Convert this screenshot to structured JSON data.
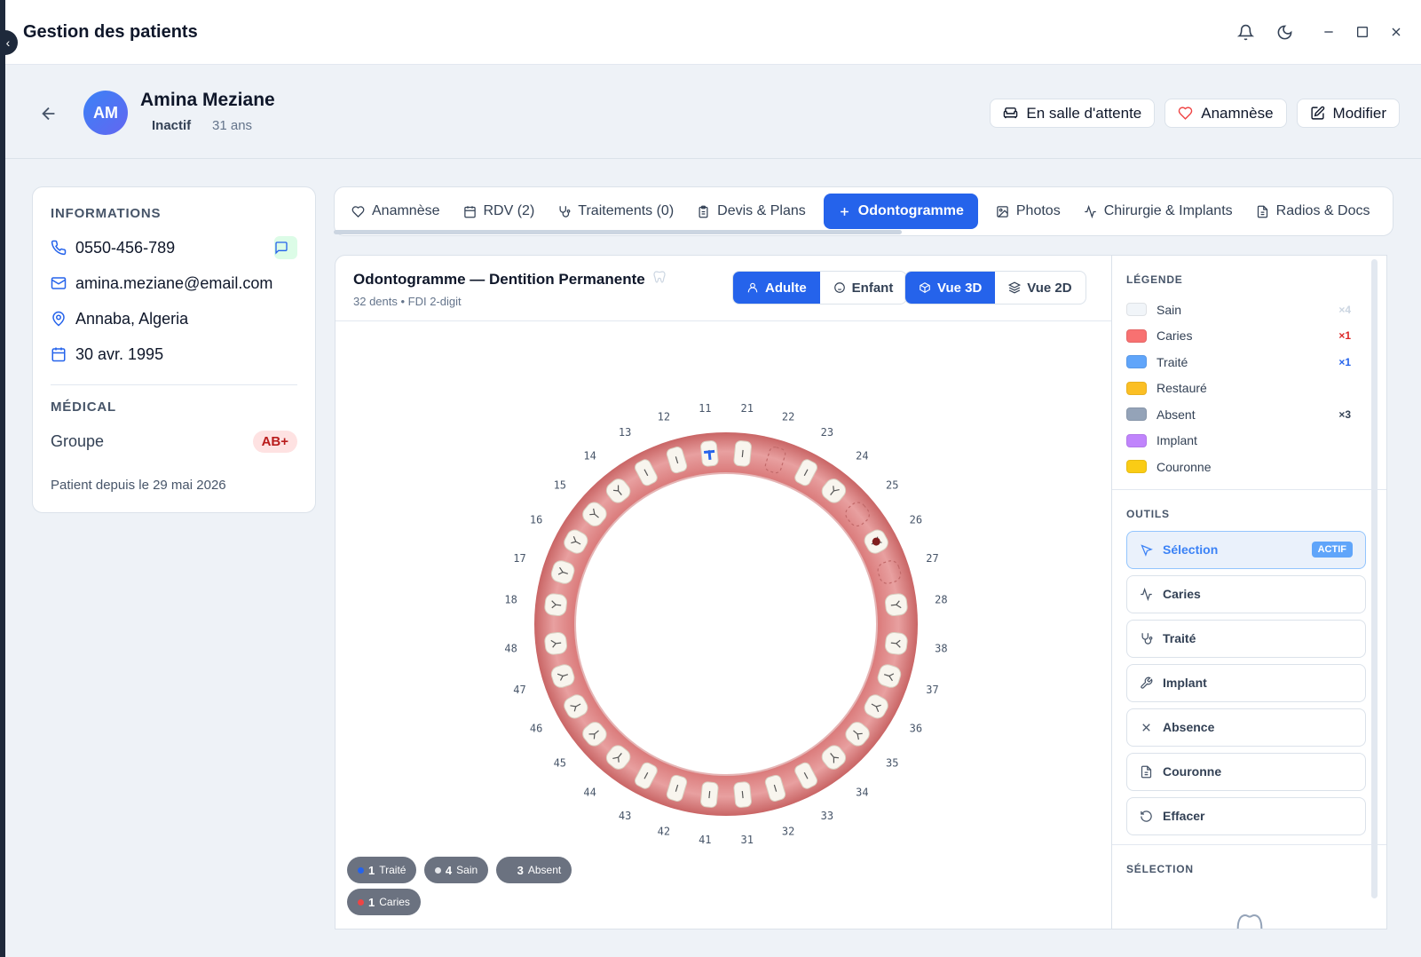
{
  "window": {
    "title": "Gestion des patients"
  },
  "patient": {
    "initials": "AM",
    "name": "Amina Meziane",
    "status": "Inactif",
    "age": "31 ans"
  },
  "header_buttons": {
    "waiting": "En salle d'attente",
    "anamnese": "Anamnèse",
    "edit": "Modifier"
  },
  "info": {
    "title": "INFORMATIONS",
    "phone": "0550-456-789",
    "email": "amina.meziane@email.com",
    "location": "Annaba, Algeria",
    "birthdate": "30 avr. 1995",
    "medical_title": "MÉDICAL",
    "group_label": "Groupe",
    "blood_group": "AB+",
    "since": "Patient depuis le 29 mai 2026"
  },
  "tabs": {
    "anamnese": "Anamnèse",
    "rdv": "RDV (2)",
    "traitements": "Traitements (0)",
    "devis": "Devis & Plans",
    "odontogramme": "Odontogramme",
    "photos": "Photos",
    "chirurgie": "Chirurgie & Implants",
    "radios": "Radios & Docs"
  },
  "odontogram": {
    "title": "Odontogramme — Dentition Permanente",
    "subtitle": "32 dents • FDI 2-digit",
    "adult": "Adulte",
    "child": "Enfant",
    "view3d": "Vue 3D",
    "view2d": "Vue 2D",
    "upper_numbers": [
      "18",
      "17",
      "16",
      "15",
      "14",
      "13",
      "12",
      "11",
      "21",
      "22",
      "23",
      "24",
      "25",
      "26",
      "27",
      "28"
    ],
    "lower_numbers": [
      "48",
      "47",
      "46",
      "45",
      "44",
      "43",
      "42",
      "41",
      "31",
      "32",
      "33",
      "34",
      "35",
      "36",
      "37",
      "38"
    ],
    "teeth_status": {
      "11": "traite",
      "26": "caries",
      "22": "absent",
      "25": "absent",
      "27": "absent"
    },
    "stats": {
      "traite": {
        "count": "1",
        "label": "Traité",
        "color": "#2563eb"
      },
      "sain": {
        "count": "4",
        "label": "Sain",
        "color": "#e5e7eb"
      },
      "absent": {
        "count": "3",
        "label": "Absent",
        "color": "#6b7280"
      },
      "caries": {
        "count": "1",
        "label": "Caries",
        "color": "#ef4444"
      }
    }
  },
  "legend": {
    "title": "LÉGENDE",
    "items": [
      {
        "label": "Sain",
        "color": "#f1f5f9",
        "count": "×4",
        "count_color": "#cbd5e1"
      },
      {
        "label": "Caries",
        "color": "#f87171",
        "count": "×1",
        "count_color": "#dc2626"
      },
      {
        "label": "Traité",
        "color": "#60a5fa",
        "count": "×1",
        "count_color": "#2563eb"
      },
      {
        "label": "Restauré",
        "color": "#fbbf24",
        "count": "",
        "count_color": "#000"
      },
      {
        "label": "Absent",
        "color": "#94a3b8",
        "count": "×3",
        "count_color": "#334155"
      },
      {
        "label": "Implant",
        "color": "#c084fc",
        "count": "",
        "count_color": "#000"
      },
      {
        "label": "Couronne",
        "color": "#facc15",
        "count": "",
        "count_color": "#000"
      }
    ]
  },
  "tools": {
    "title": "OUTILS",
    "selection": "Sélection",
    "active_badge": "ACTIF",
    "caries": "Caries",
    "traite": "Traité",
    "implant": "Implant",
    "absence": "Absence",
    "couronne": "Couronne",
    "effacer": "Effacer"
  },
  "selection_panel": {
    "title": "SÉLECTION"
  }
}
